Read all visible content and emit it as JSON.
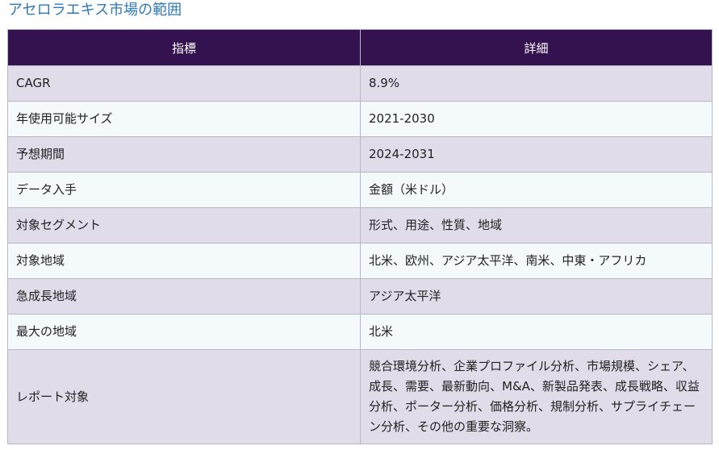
{
  "page": {
    "title": "アセロラエキス市場の範囲"
  },
  "table": {
    "headers": [
      "指標",
      "詳細"
    ],
    "rows": [
      [
        "CAGR",
        "8.9%"
      ],
      [
        "年使用可能サイズ",
        "2021-2030"
      ],
      [
        "予想期間",
        "2024-2031"
      ],
      [
        "データ入手",
        "金額（米ドル）"
      ],
      [
        "対象セグメント",
        "形式、用途、性質、地域"
      ],
      [
        "対象地域",
        "北米、欧州、アジア太平洋、南米、中東・アフリカ"
      ],
      [
        "急成長地域",
        "アジア太平洋"
      ],
      [
        "最大の地域",
        "北米"
      ],
      [
        "レポート対象",
        "競合環境分析、企業プロファイル分析、市場規模、シェア、成長、需要、最新動向、M&A、新製品発表、成長戦略、収益分析、ポーター分析、価格分析、規制分析、サプライチェーン分析、その他の重要な洞察。"
      ]
    ]
  },
  "colors": {
    "title": "#2d7ab7",
    "header_bg": "#34124f",
    "row_odd_bg": "#e0dcea",
    "row_even_bg": "#f4f9fb",
    "border": "#b9b6c6"
  }
}
